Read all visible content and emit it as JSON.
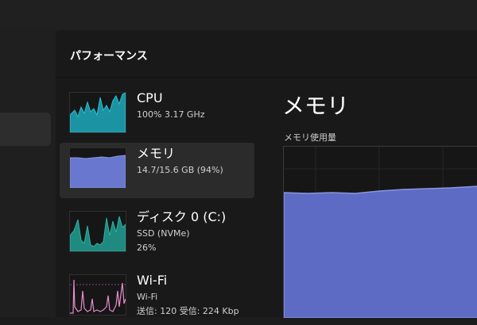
{
  "panel": {
    "title": "パフォーマンス"
  },
  "items": [
    {
      "id": "cpu",
      "title": "CPU",
      "line1": "100%  3.17 GHz",
      "line2": "",
      "color": "#1fb0c0"
    },
    {
      "id": "memory",
      "title": "メモリ",
      "line1": "14.7/15.6 GB (94%)",
      "line2": "",
      "color": "#6b7ad4",
      "selected": true
    },
    {
      "id": "disk",
      "title": "ディスク 0 (C:)",
      "line1": "SSD (NVMe)",
      "line2": "26%",
      "color": "#2aa59a"
    },
    {
      "id": "wifi",
      "title": "Wi-Fi",
      "line1": "Wi-Fi",
      "line2": "送信: 120  受信: 224 Kbp",
      "color": "#e88ccf"
    }
  ],
  "detail": {
    "title": "メモリ",
    "graph_label": "メモリ使用量",
    "usage_percent": 94,
    "fill_color": "#5d6bc4"
  }
}
